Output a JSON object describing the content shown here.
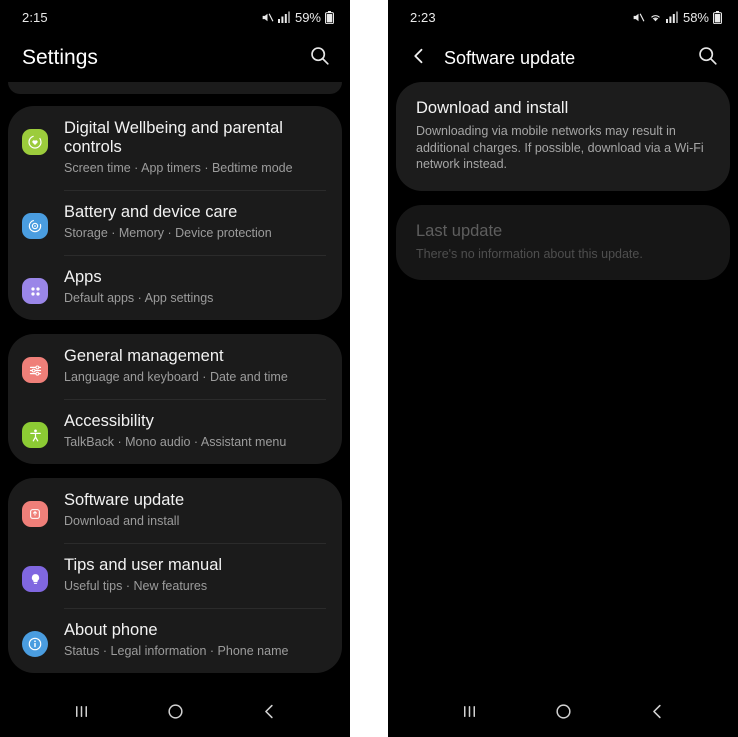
{
  "theme": {
    "background": "#000000",
    "card_background": "#1b1b1b",
    "card_background_disabled": "#161616",
    "title_color": "#f2f2f2",
    "subtitle_color": "#9c9c9c",
    "divider_color": "#2b2b2b",
    "gap_color": "#ffffff"
  },
  "settings_screen": {
    "status_bar": {
      "time": "2:15",
      "battery_percent": "59%",
      "icons": [
        "mute-icon",
        "signal-bars-icon",
        "battery-icon"
      ]
    },
    "app_bar": {
      "title": "Settings",
      "search_icon": "search-icon"
    },
    "groups": [
      {
        "clipped": true,
        "items": []
      },
      {
        "clipped": false,
        "items": [
          {
            "title": "Digital Wellbeing and parental controls",
            "subtitle": "Screen time  ·  App timers  ·  Bedtime mode",
            "icon": "digital-wellbeing-icon",
            "icon_color": "#9ccc3c"
          },
          {
            "title": "Battery and device care",
            "subtitle": "Storage  ·  Memory  ·  Device protection",
            "icon": "battery-device-care-icon",
            "icon_color": "#4a9de0"
          },
          {
            "title": "Apps",
            "subtitle": "Default apps  ·  App settings",
            "icon": "apps-icon",
            "icon_color": "#9a86e8"
          }
        ]
      },
      {
        "clipped": false,
        "items": [
          {
            "title": "General management",
            "subtitle": "Language and keyboard  ·  Date and time",
            "icon": "general-management-icon",
            "icon_color": "#ef7f79"
          },
          {
            "title": "Accessibility",
            "subtitle": "TalkBack  ·  Mono audio  ·  Assistant menu",
            "icon": "accessibility-icon",
            "icon_color": "#8ccb34"
          }
        ]
      },
      {
        "clipped": false,
        "items": [
          {
            "title": "Software update",
            "subtitle": "Download and install",
            "icon": "software-update-icon",
            "icon_color": "#ef7f79"
          },
          {
            "title": "Tips and user manual",
            "subtitle": "Useful tips  ·  New features",
            "icon": "tips-icon",
            "icon_color": "#8067e0"
          },
          {
            "title": "About phone",
            "subtitle": "Status  ·  Legal information  ·  Phone name",
            "icon": "about-phone-icon",
            "icon_color": "#4a9de0"
          }
        ]
      }
    ],
    "nav_bar": {
      "recents": "recents-icon",
      "home": "home-icon",
      "back": "back-icon"
    }
  },
  "update_screen": {
    "status_bar": {
      "time": "2:23",
      "battery_percent": "58%",
      "icons": [
        "mute-icon",
        "wifi-icon",
        "signal-bars-icon",
        "battery-icon"
      ]
    },
    "app_bar": {
      "back_icon": "back-chevron-icon",
      "title": "Software update",
      "search_icon": "search-icon"
    },
    "cards": [
      {
        "title": "Download and install",
        "description": "Downloading via mobile networks may result in additional charges. If possible, download via a Wi-Fi network instead.",
        "disabled": false
      },
      {
        "title": "Last update",
        "description": "There's no information about this update.",
        "disabled": true
      }
    ],
    "nav_bar": {
      "recents": "recents-icon",
      "home": "home-icon",
      "back": "back-icon"
    }
  }
}
